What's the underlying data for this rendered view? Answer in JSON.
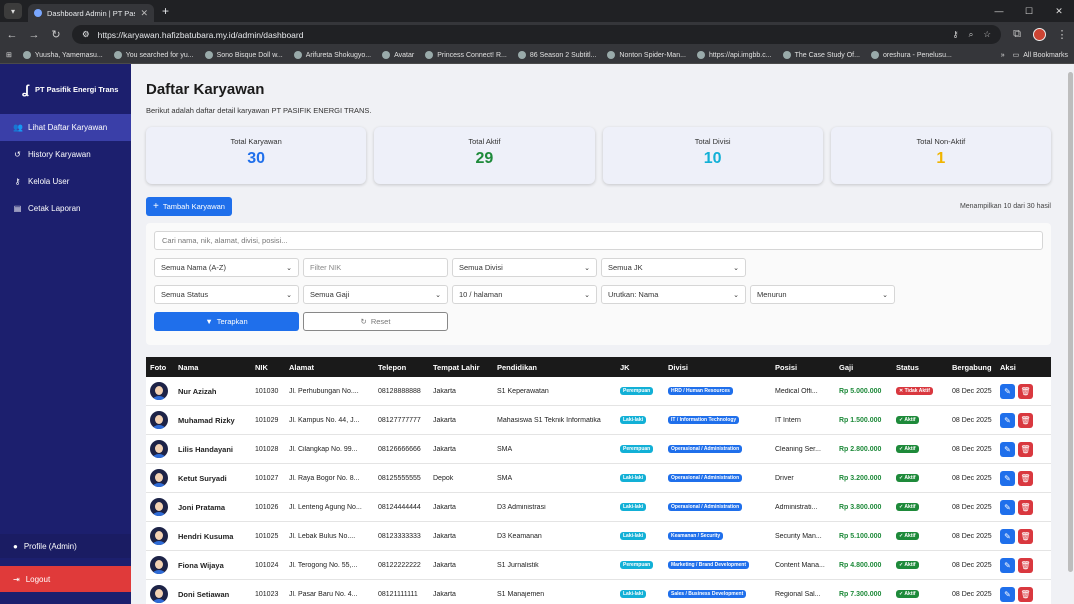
{
  "browser": {
    "tab_title": "Dashboard Admin | PT Pasifik E",
    "url": "https://karyawan.hafizbatubara.my.id/admin/dashboard",
    "bookmarks": [
      "Yuusha, Yamemasu...",
      "You searched for yu...",
      "Sono Bisque Doll w...",
      "Arifureta Shokugyo...",
      "Avatar",
      "Princess Connect! R...",
      "86 Season 2 Subtitl...",
      "Nonton Spider-Man...",
      "https://api.imgbb.c...",
      "The Case Study Of...",
      "oreshura - Penelusu..."
    ],
    "all_bookmarks": "All Bookmarks"
  },
  "sidebar": {
    "brand": "PT Pasifik Energi Trans",
    "items": [
      {
        "label": "Lihat Daftar Karyawan"
      },
      {
        "label": "History Karyawan"
      },
      {
        "label": "Kelola User"
      },
      {
        "label": "Cetak Laporan"
      }
    ],
    "profile": "Profile (Admin)",
    "logout": "Logout"
  },
  "page": {
    "title": "Daftar Karyawan",
    "subtitle": "Berikut adalah daftar detail karyawan PT PASIFIK ENERGI TRANS."
  },
  "stats": [
    {
      "label": "Total Karyawan",
      "value": "30",
      "color": "#1f6feb"
    },
    {
      "label": "Total Aktif",
      "value": "29",
      "color": "#1e8a3a"
    },
    {
      "label": "Total Divisi",
      "value": "10",
      "color": "#12b0d6"
    },
    {
      "label": "Total Non-Aktif",
      "value": "1",
      "color": "#f0b400"
    }
  ],
  "toolbar": {
    "add_label": "Tambah Karyawan",
    "showing": "Menampilkan 10 dari 30 hasil"
  },
  "filters": {
    "search_placeholder": "Cari nama, nik, alamat, divisi, posisi...",
    "nama": "Semua Nama (A-Z)",
    "nik_placeholder": "Filter NIK",
    "divisi": "Semua Divisi",
    "jk": "Semua JK",
    "status": "Semua Status",
    "gaji": "Semua Gaji",
    "per_page": "10 / halaman",
    "sort": "Urutkan: Nama",
    "order": "Menurun",
    "apply": "Terapkan",
    "reset": "Reset"
  },
  "table": {
    "headers": [
      "Foto",
      "Nama",
      "NIK",
      "Alamat",
      "Telepon",
      "Tempat Lahir",
      "Pendidikan",
      "JK",
      "Divisi",
      "Posisi",
      "Gaji",
      "Status",
      "Bergabung",
      "Aksi"
    ],
    "rows": [
      {
        "nama": "Nur Azizah",
        "nik": "101030",
        "alamat": "Jl. Perhubungan No....",
        "telepon": "08128888888",
        "tempat": "Jakarta",
        "pendidikan": "S1 Keperawatan",
        "jk": "Perempuan",
        "divisi": "HRD / Human Resources",
        "posisi": "Medical Offi...",
        "gaji": "Rp 5.000.000",
        "status": "Tidak Aktif",
        "aktif": false,
        "bergabung": "08 Dec 2025"
      },
      {
        "nama": "Muhamad Rizky",
        "nik": "101029",
        "alamat": "Jl. Kampus No. 44, J...",
        "telepon": "08127777777",
        "tempat": "Jakarta",
        "pendidikan": "Mahasiswa S1 Teknik Informatika",
        "jk": "Laki-laki",
        "divisi": "IT / Information Technology",
        "posisi": "IT Intern",
        "gaji": "Rp 1.500.000",
        "status": "Aktif",
        "aktif": true,
        "bergabung": "08 Dec 2025"
      },
      {
        "nama": "Lilis Handayani",
        "nik": "101028",
        "alamat": "Jl. Cilangkap No. 99...",
        "telepon": "08126666666",
        "tempat": "Jakarta",
        "pendidikan": "SMA",
        "jk": "Perempuan",
        "divisi": "Operasional / Administration",
        "posisi": "Cleaning Ser...",
        "gaji": "Rp 2.800.000",
        "status": "Aktif",
        "aktif": true,
        "bergabung": "08 Dec 2025"
      },
      {
        "nama": "Ketut Suryadi",
        "nik": "101027",
        "alamat": "Jl. Raya Bogor No. 8...",
        "telepon": "08125555555",
        "tempat": "Depok",
        "pendidikan": "SMA",
        "jk": "Laki-laki",
        "divisi": "Operasional / Administration",
        "posisi": "Driver",
        "gaji": "Rp 3.200.000",
        "status": "Aktif",
        "aktif": true,
        "bergabung": "08 Dec 2025"
      },
      {
        "nama": "Joni Pratama",
        "nik": "101026",
        "alamat": "Jl. Lenteng Agung No...",
        "telepon": "08124444444",
        "tempat": "Jakarta",
        "pendidikan": "D3 Administrasi",
        "jk": "Laki-laki",
        "divisi": "Operasional / Administration",
        "posisi": "Administrati...",
        "gaji": "Rp 3.800.000",
        "status": "Aktif",
        "aktif": true,
        "bergabung": "08 Dec 2025"
      },
      {
        "nama": "Hendri Kusuma",
        "nik": "101025",
        "alamat": "Jl. Lebak Bulus No....",
        "telepon": "08123333333",
        "tempat": "Jakarta",
        "pendidikan": "D3 Keamanan",
        "jk": "Laki-laki",
        "divisi": "Keamanan / Security",
        "posisi": "Security Man...",
        "gaji": "Rp 5.100.000",
        "status": "Aktif",
        "aktif": true,
        "bergabung": "08 Dec 2025"
      },
      {
        "nama": "Fiona Wijaya",
        "nik": "101024",
        "alamat": "Jl. Terogong No. 55,...",
        "telepon": "08122222222",
        "tempat": "Jakarta",
        "pendidikan": "S1 Jurnalistik",
        "jk": "Perempuan",
        "divisi": "Marketing / Brand Development",
        "posisi": "Content Mana...",
        "gaji": "Rp 4.800.000",
        "status": "Aktif",
        "aktif": true,
        "bergabung": "08 Dec 2025"
      },
      {
        "nama": "Doni Setiawan",
        "nik": "101023",
        "alamat": "Jl. Pasar Baru No. 4...",
        "telepon": "08121111111",
        "tempat": "Jakarta",
        "pendidikan": "S1 Manajemen",
        "jk": "Laki-laki",
        "divisi": "Sales / Business Development",
        "posisi": "Regional Sal...",
        "gaji": "Rp 7.300.000",
        "status": "Aktif",
        "aktif": true,
        "bergabung": "08 Dec 2025"
      }
    ]
  }
}
